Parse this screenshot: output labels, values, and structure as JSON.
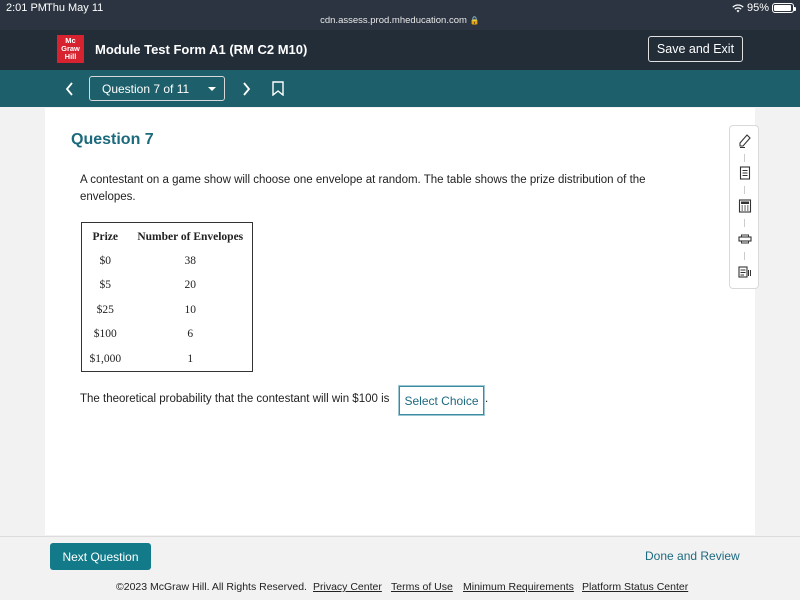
{
  "status": {
    "time": "2:01 PM",
    "date": "Thu May 11",
    "url": "cdn.assess.prod.mheducation.com",
    "battery": "95%",
    "battery_level": 0.95
  },
  "header": {
    "logo": [
      "Mc",
      "Graw",
      "Hill"
    ],
    "title": "Module Test Form A1 (RM C2 M10)",
    "save_exit": "Save and Exit"
  },
  "nav": {
    "question_select": "Question 7 of 11"
  },
  "question": {
    "title": "Question 7",
    "prompt": "A contestant on a game show will choose one envelope at random. The table shows the prize distribution of the envelopes.",
    "table": {
      "headers": [
        "Prize",
        "Number of Envelopes"
      ],
      "rows": [
        [
          "$0",
          "38"
        ],
        [
          "$5",
          "20"
        ],
        [
          "$25",
          "10"
        ],
        [
          "$100",
          "6"
        ],
        [
          "$1,000",
          "1"
        ]
      ]
    },
    "answer_prefix": "The theoretical probability that the contestant will win $100 is",
    "select_choice": "Select Choice",
    "answer_suffix": "."
  },
  "tools": [
    "pencil-icon",
    "notepad-icon",
    "calculator-icon",
    "print-icon",
    "reference-icon"
  ],
  "footer": {
    "next": "Next Question",
    "done": "Done and Review",
    "copyright": "©2023 McGraw Hill. All Rights Reserved.",
    "links": [
      "Privacy Center",
      "Terms of Use",
      "Minimum Requirements",
      "Platform Status Center"
    ]
  },
  "colors": {
    "header": "#222d38",
    "nav": "#1d5f6a",
    "accent": "#127a89",
    "title": "#1b6a7d",
    "logo": "#d6232f"
  }
}
